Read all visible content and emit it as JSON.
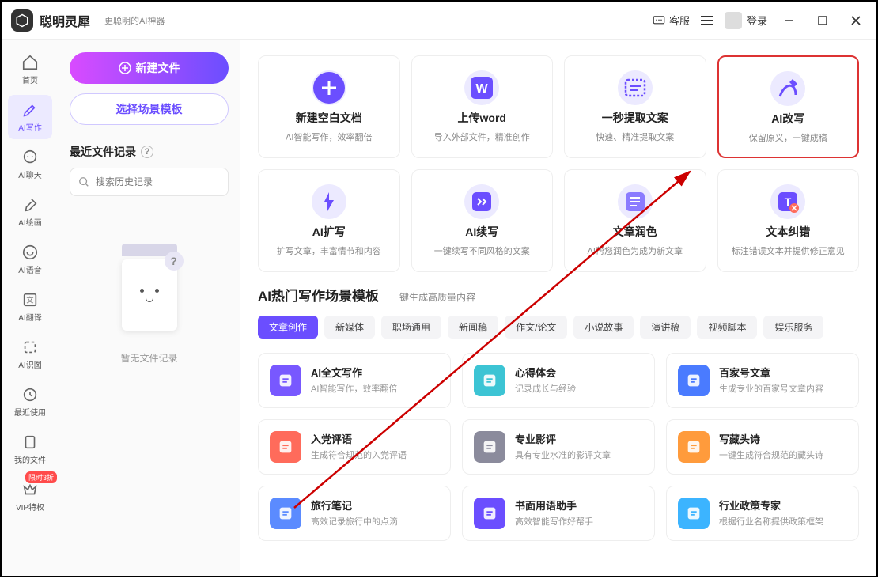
{
  "app": {
    "name": "聪明灵犀",
    "slogan": "更聪明的AI神器"
  },
  "topbar": {
    "kefu": "客服",
    "login": "登录"
  },
  "sidebar": {
    "items": [
      {
        "label": "首页",
        "icon": "home"
      },
      {
        "label": "AI写作",
        "icon": "pen",
        "active": true
      },
      {
        "label": "AI聊天",
        "icon": "chat"
      },
      {
        "label": "AI绘画",
        "icon": "brush"
      },
      {
        "label": "AI语音",
        "icon": "voice"
      },
      {
        "label": "AI翻译",
        "icon": "translate"
      },
      {
        "label": "AI识图",
        "icon": "scan"
      },
      {
        "label": "最近使用",
        "icon": "clock"
      },
      {
        "label": "我的文件",
        "icon": "file"
      },
      {
        "label": "VIP特权",
        "icon": "vip",
        "badge": "限时3折"
      }
    ]
  },
  "leftpanel": {
    "new_btn": "新建文件",
    "template_btn": "选择场景模板",
    "recent_title": "最近文件记录",
    "search_placeholder": "搜索历史记录",
    "empty": "暂无文件记录"
  },
  "actions": [
    {
      "title": "新建空白文档",
      "desc": "AI智能写作，效率翻倍",
      "icon": "plus",
      "color": "#6b4eff"
    },
    {
      "title": "上传word",
      "desc": "导入外部文件，精准创作",
      "icon": "word",
      "color": "#6b4eff"
    },
    {
      "title": "一秒提取文案",
      "desc": "快速、精准提取文案",
      "icon": "extract",
      "color": "#6b4eff"
    },
    {
      "title": "AI改写",
      "desc": "保留原义，一键成稿",
      "icon": "rewrite",
      "color": "#6b4eff",
      "highlight": true
    },
    {
      "title": "AI扩写",
      "desc": "扩写文章，丰富情节和内容",
      "icon": "expand",
      "color": "#6b4eff"
    },
    {
      "title": "AI续写",
      "desc": "一键续写不同风格的文案",
      "icon": "continue",
      "color": "#6b4eff"
    },
    {
      "title": "文章润色",
      "desc": "AI帮您润色为成为新文章",
      "icon": "polish",
      "color": "#6b4eff"
    },
    {
      "title": "文本纠错",
      "desc": "标注错误文本并提供修正意见",
      "icon": "correct",
      "color": "#6b4eff"
    }
  ],
  "section": {
    "title": "AI热门写作场景模板",
    "sub": "一键生成高质量内容"
  },
  "tabs": [
    "文章创作",
    "新媒体",
    "职场通用",
    "新闻稿",
    "作文/论文",
    "小说故事",
    "演讲稿",
    "视频脚本",
    "娱乐服务"
  ],
  "active_tab": "文章创作",
  "templates": [
    {
      "title": "AI全文写作",
      "desc": "AI智能写作，效率翻倍",
      "color": "#7858ff"
    },
    {
      "title": "心得体会",
      "desc": "记录成长与经验",
      "color": "#3cc4d4"
    },
    {
      "title": "百家号文章",
      "desc": "生成专业的百家号文章内容",
      "color": "#4a7bff"
    },
    {
      "title": "入党评语",
      "desc": "生成符合规范的入党评语",
      "color": "#ff6b5b"
    },
    {
      "title": "专业影评",
      "desc": "具有专业水准的影评文章",
      "color": "#8b8b9c"
    },
    {
      "title": "写藏头诗",
      "desc": "一键生成符合规范的藏头诗",
      "color": "#ff9b3c"
    },
    {
      "title": "旅行笔记",
      "desc": "高效记录旅行中的点滴",
      "color": "#5b8bff"
    },
    {
      "title": "书面用语助手",
      "desc": "高效智能写作好帮手",
      "color": "#6b4eff"
    },
    {
      "title": "行业政策专家",
      "desc": "根据行业名称提供政策框架",
      "color": "#3cb4ff"
    }
  ]
}
